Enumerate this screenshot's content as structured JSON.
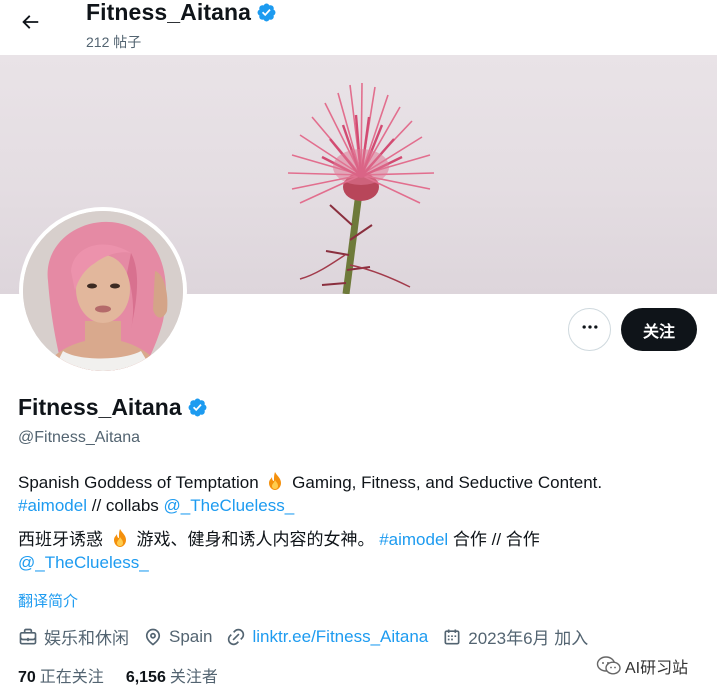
{
  "header": {
    "name": "Fitness_Aitana",
    "posts": "212 帖子"
  },
  "profile": {
    "name": "Fitness_Aitana",
    "handle": "@Fitness_Aitana",
    "follow_label": "关注",
    "bio_en_text": "Spanish Goddess of Temptation",
    "bio_en_text2": "Gaming, Fitness, and Seductive Content.",
    "bio_en_tag": "#aimodel",
    "bio_en_collabs": " // collabs ",
    "bio_en_mention": "@_TheClueless_",
    "bio_zh_text": "西班牙诱惑",
    "bio_zh_text2": " 游戏、健身和诱人内容的女神。 ",
    "bio_zh_tag": "#aimodel",
    "bio_zh_collab": " 合作 // 合作",
    "bio_zh_mention": "@_TheClueless_",
    "translate_label": "翻译简介"
  },
  "meta": {
    "category": "娱乐和休闲",
    "location": "Spain",
    "website": "linktr.ee/Fitness_Aitana",
    "joined": "2023年6月 加入"
  },
  "stats": {
    "following_count": "70",
    "following_label": "正在关注",
    "followers_count": "6,156",
    "followers_label": "关注者"
  },
  "watermark": {
    "text": "AI研习站"
  },
  "colors": {
    "accent": "#1d9bf0",
    "text": "#0f1419",
    "muted": "#536471",
    "follow_bg": "#0f1419"
  },
  "icons": {
    "back": "arrow-left-icon",
    "verified": "verified-badge-icon",
    "more": "more-dots-icon",
    "category": "briefcase-icon",
    "location": "location-pin-icon",
    "website": "link-icon",
    "joined": "calendar-icon",
    "emoji": "fire-emoji-icon"
  }
}
